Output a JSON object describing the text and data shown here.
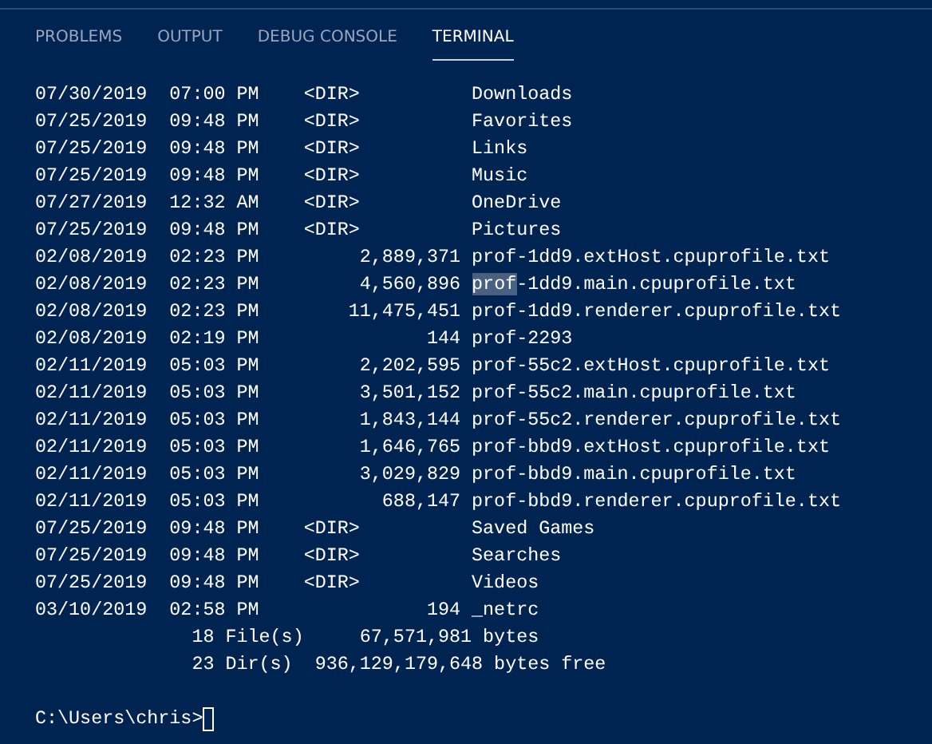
{
  "tabs": [
    {
      "label": "PROBLEMS",
      "selected": false
    },
    {
      "label": "OUTPUT",
      "selected": false
    },
    {
      "label": "DEBUG CONSOLE",
      "selected": false
    },
    {
      "label": "TERMINAL",
      "selected": true
    }
  ],
  "terminal": {
    "lines": [
      {
        "text": "07/30/2019  07:00 PM    <DIR>          Downloads"
      },
      {
        "text": "07/25/2019  09:48 PM    <DIR>          Favorites"
      },
      {
        "text": "07/25/2019  09:48 PM    <DIR>          Links"
      },
      {
        "text": "07/25/2019  09:48 PM    <DIR>          Music"
      },
      {
        "text": "07/27/2019  12:32 AM    <DIR>          OneDrive"
      },
      {
        "text": "07/25/2019  09:48 PM    <DIR>          Pictures"
      },
      {
        "text": "02/08/2019  02:23 PM         2,889,371 prof-1dd9.extHost.cpuprofile.txt"
      },
      {
        "text": "02/08/2019  02:23 PM         4,560,896 ",
        "selected_text": "prof",
        "after": "-1dd9.main.cpuprofile.txt"
      },
      {
        "text": "02/08/2019  02:23 PM        11,475,451 prof-1dd9.renderer.cpuprofile.txt"
      },
      {
        "text": "02/08/2019  02:19 PM               144 prof-2293"
      },
      {
        "text": "02/11/2019  05:03 PM         2,202,595 prof-55c2.extHost.cpuprofile.txt"
      },
      {
        "text": "02/11/2019  05:03 PM         3,501,152 prof-55c2.main.cpuprofile.txt"
      },
      {
        "text": "02/11/2019  05:03 PM         1,843,144 prof-55c2.renderer.cpuprofile.txt"
      },
      {
        "text": "02/11/2019  05:03 PM         1,646,765 prof-bbd9.extHost.cpuprofile.txt"
      },
      {
        "text": "02/11/2019  05:03 PM         3,029,829 prof-bbd9.main.cpuprofile.txt"
      },
      {
        "text": "02/11/2019  05:03 PM           688,147 prof-bbd9.renderer.cpuprofile.txt"
      },
      {
        "text": "07/25/2019  09:48 PM    <DIR>          Saved Games"
      },
      {
        "text": "07/25/2019  09:48 PM    <DIR>          Searches"
      },
      {
        "text": "07/25/2019  09:48 PM    <DIR>          Videos"
      },
      {
        "text": "03/10/2019  02:58 PM               194 _netrc"
      },
      {
        "text": "              18 File(s)     67,571,981 bytes"
      },
      {
        "text": "              23 Dir(s)  936,129,179,648 bytes free"
      }
    ],
    "prompt": "C:\\Users\\chris>"
  }
}
